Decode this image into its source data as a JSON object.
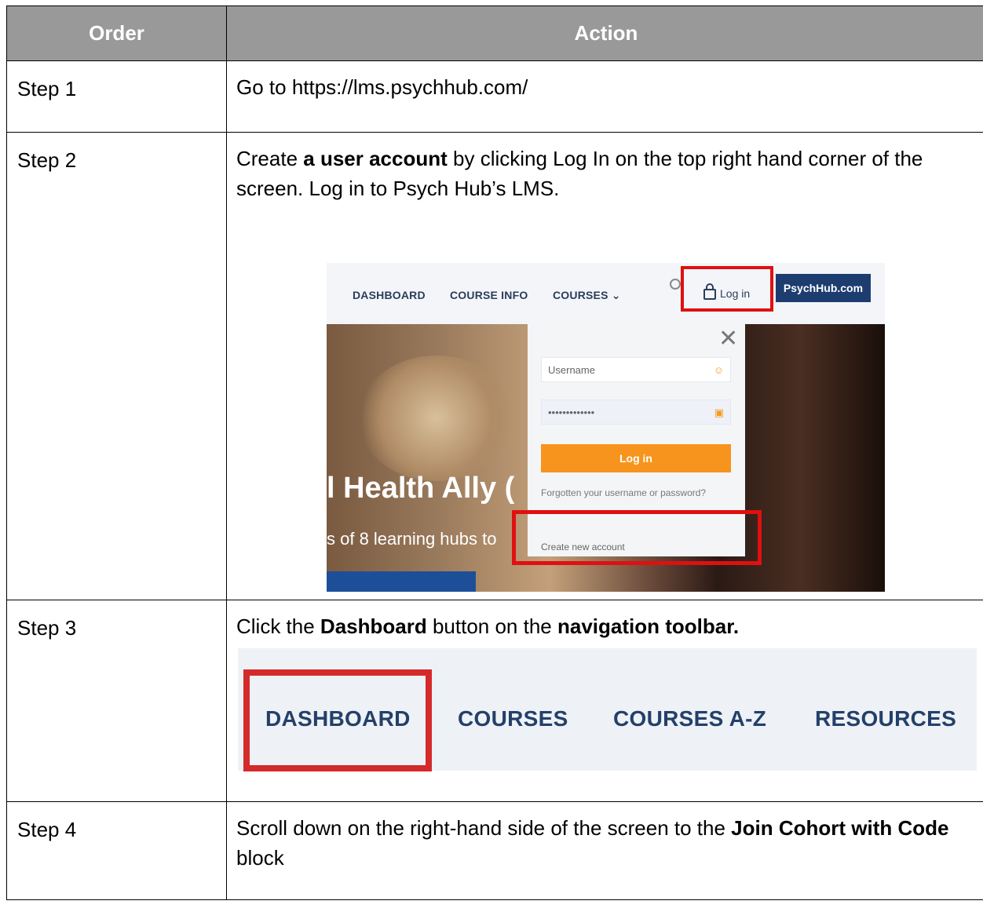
{
  "table": {
    "headers": {
      "order": "Order",
      "action": "Action"
    },
    "steps": [
      {
        "order": "Step 1",
        "text": "Go to https://lms.psychhub.com/"
      },
      {
        "order": "Step 2",
        "text_before": "Create ",
        "bold": "a user account",
        "text_after": " by clicking Log In on the top right hand corner of the screen. Log in to Psych Hub’s LMS."
      },
      {
        "order": "Step 3",
        "t1": "Click the ",
        "b1": "Dashboard",
        "t2": " button on the ",
        "b2": "navigation toolbar."
      },
      {
        "order": "Step 4",
        "t1": "Scroll down on the right-hand side of the screen to the ",
        "b1": "Join Cohort with Code",
        "t2": " block"
      }
    ]
  },
  "step2_screenshot": {
    "nav": [
      "DASHBOARD",
      "COURSE INFO",
      "COURSES ⌄"
    ],
    "login_label": "Log in",
    "brand_button": "PsychHub.com",
    "hero_title": "l Health Ally (",
    "hero_subtitle": "s of 8 learning hubs to",
    "login_panel": {
      "close": "✕",
      "username_placeholder": "Username",
      "password_value": "•••••••••••••",
      "button": "Log in",
      "forgot": "Forgotten your username or password?",
      "create": "Create new account"
    },
    "highlight_color": "#e01010"
  },
  "step3_screenshot": {
    "nav": [
      "DASHBOARD",
      "COURSES",
      "COURSES A-Z",
      "RESOURCES"
    ],
    "highlight_color": "#d42a2a"
  }
}
